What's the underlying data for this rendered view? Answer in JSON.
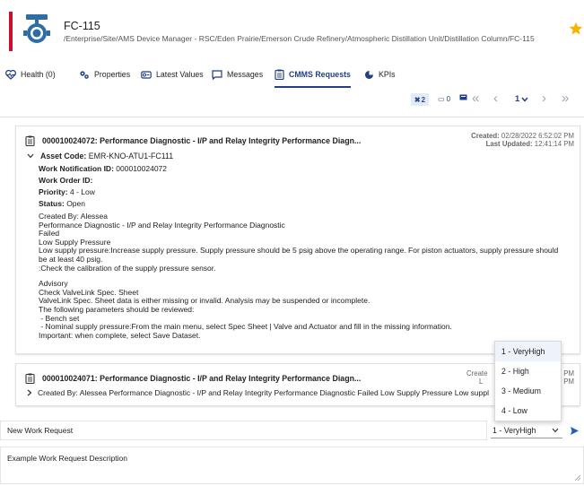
{
  "header": {
    "device_name": "FC-115",
    "path": "/Enterprise/Site/AMS Device Manager - RSC/Eden Prairie/Emerson Crude Refinery/Atmospheric Distillation Unit/Distillation Column/FC-115",
    "accent_color": "#c8102e",
    "favorite_color": "#f5b400"
  },
  "tabs": [
    {
      "label": "Health (0)",
      "icon": "heart-pulse-icon"
    },
    {
      "label": "Properties",
      "icon": "gears-icon"
    },
    {
      "label": "Latest Values",
      "icon": "values-icon"
    },
    {
      "label": "Messages",
      "icon": "message-icon"
    },
    {
      "label": "CMMS Requests",
      "icon": "clipboard-icon",
      "active": true
    },
    {
      "label": "KPIs",
      "icon": "chart-pie-icon"
    }
  ],
  "toolbar": {
    "filter_count": "2",
    "archive_count": "0",
    "page": "1"
  },
  "requests": [
    {
      "title": "000010024072: Performance Diagnostic - I/P and Relay Integrity Performance Diagn...",
      "created_label": "Created:",
      "created": "02/28/2022 6:52:02 PM",
      "updated_label": "Last Updated:",
      "updated": "12:41:14 PM",
      "asset_label": "Asset Code:",
      "asset_code": "EMR-KNO-ATU1-FC111",
      "work_notification_label": "Work Notification ID:",
      "work_notification": "000010024072",
      "work_order_label": "Work Order ID:",
      "work_order": "",
      "priority_label": "Priority:",
      "priority": "4 - Low",
      "status_label": "Status:",
      "status": "Open",
      "description_lines": [
        "Created By: Alessea",
        "Performance Diagnostic - I/P and Relay Integrity Performance Diagnostic",
        "Failed",
        "Low Supply Pressure",
        "Low supply pressure:Increase supply pressure.  Supply pressure should be 5 psig above the operating range.  For piston actuators, supply pressure should",
        "be at least 40 psig.",
        ":Check the calibration of the supply pressure sensor.",
        "",
        "Advisory",
        "Check ValveLink Spec. Sheet",
        "ValveLink Spec. Sheet data is either missing or invalid.  Analysis may be suspended or incomplete.",
        "The following parameters should be reviewed:",
        " - Bench set",
        " - Nominal supply pressure:From the main menu, select Spec Sheet | Valve and Actuator and fill in the missing information.",
        "Important:  when complete, select Save Dataset."
      ]
    },
    {
      "title": "000010024071: Performance Diagnostic - I/P and Relay Integrity Performance Diagn...",
      "created_label": "Create",
      "updated_label": "L",
      "created_suffix": "PM",
      "updated_suffix": "PM",
      "summary": "Created By: Alessea Performance Diagnostic - I/P and Relay Integrity Performance Diagnostic Failed Low Supply Pressure Low suppl"
    }
  ],
  "priority_dropdown": {
    "options": [
      "1 - VeryHigh",
      "2 - High",
      "3 - Medium",
      "4 - Low"
    ],
    "highlighted": "1 - VeryHigh"
  },
  "new_request": {
    "title_value": "New Work Request",
    "priority_value": "1 - VeryHigh",
    "description_value": "Example Work Request Description"
  }
}
